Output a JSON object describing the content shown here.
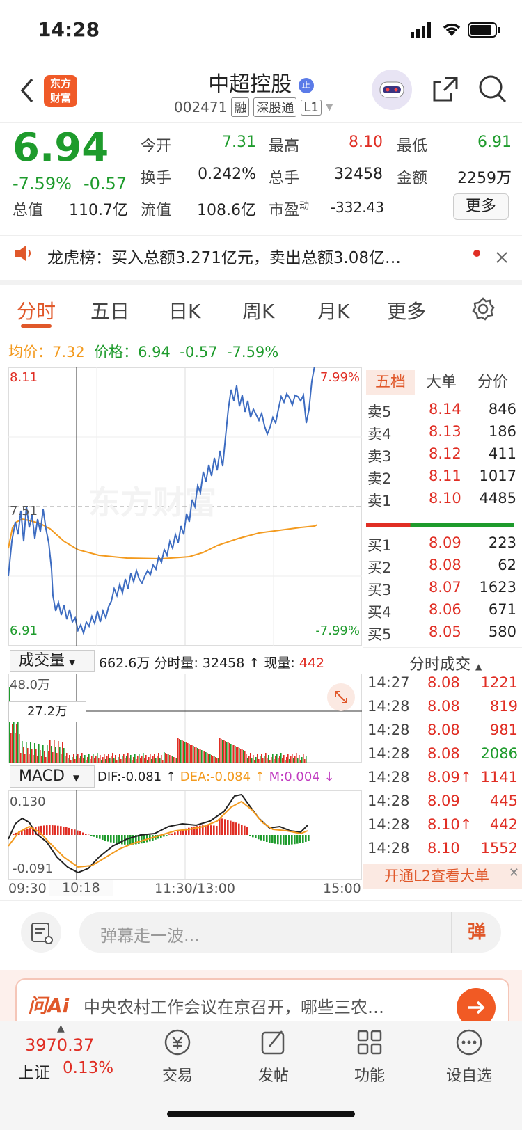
{
  "status_bar": {
    "time": "14:28"
  },
  "header": {
    "logo_text": "东方财富",
    "title": "中超控股",
    "title_badge": "正",
    "code": "002471",
    "tags": [
      "融",
      "深股通",
      "L1"
    ]
  },
  "quote": {
    "price": "6.94",
    "change_pct": "-7.59%",
    "change": "-0.57",
    "fields": [
      {
        "label": "今开",
        "value": "7.31",
        "color": "green"
      },
      {
        "label": "最高",
        "value": "8.10",
        "color": "red"
      },
      {
        "label": "最低",
        "value": "6.91",
        "color": "green"
      },
      {
        "label": "换手",
        "value": "0.242%",
        "color": "black"
      },
      {
        "label": "总手",
        "value": "32458",
        "color": "black"
      },
      {
        "label": "金额",
        "value": "2259万",
        "color": "black"
      },
      {
        "label": "总值",
        "value": "110.7亿",
        "color": "black"
      },
      {
        "label": "流值",
        "value": "108.6亿",
        "color": "black"
      },
      {
        "label": "市盈",
        "value": "-332.43",
        "color": "black",
        "sup": "动"
      }
    ],
    "more_label": "更多"
  },
  "news": {
    "text": "龙虎榜：买入总额3.271亿元，卖出总额3.08亿…"
  },
  "tabs": [
    "分时",
    "五日",
    "日K",
    "周K",
    "月K",
    "更多"
  ],
  "avg_line": {
    "avg_label": "均价：",
    "avg_value": "7.32",
    "price_label": "价格：",
    "price_value": "6.94",
    "change": "-0.57",
    "change_pct": "-7.59%"
  },
  "chart_labels": {
    "top_price": "8.11",
    "bottom_price": "6.91",
    "mid_price": "7.51",
    "top_pct": "7.99%",
    "bottom_pct": "-7.99%",
    "watermark": "东方财富",
    "time_start": "09:30",
    "time_cursor": "10:18",
    "time_mid": "11:30/13:00",
    "time_end": "15:00"
  },
  "volume": {
    "selector": "成交量",
    "total": "662.6万",
    "label": "分时量:",
    "value": "32458",
    "now_label": "现量:",
    "now_value": "442",
    "max": "48.0万",
    "cursor": "27.2万"
  },
  "macd": {
    "selector": "MACD",
    "dif": "DIF:-0.081",
    "dea": "DEA:-0.084",
    "m": "M:0.004",
    "top": "0.130",
    "bottom": "-0.091"
  },
  "orderbook": {
    "tabs": [
      "五档",
      "大单",
      "分价"
    ],
    "sell": [
      {
        "label": "卖5",
        "price": "8.14",
        "vol": "846"
      },
      {
        "label": "卖4",
        "price": "8.13",
        "vol": "186"
      },
      {
        "label": "卖3",
        "price": "8.12",
        "vol": "411"
      },
      {
        "label": "卖2",
        "price": "8.11",
        "vol": "1017"
      },
      {
        "label": "卖1",
        "price": "8.10",
        "vol": "4485"
      }
    ],
    "buy": [
      {
        "label": "买1",
        "price": "8.09",
        "vol": "223"
      },
      {
        "label": "买2",
        "price": "8.08",
        "vol": "62"
      },
      {
        "label": "买3",
        "price": "8.07",
        "vol": "1623"
      },
      {
        "label": "买4",
        "price": "8.06",
        "vol": "671"
      },
      {
        "label": "买5",
        "price": "8.05",
        "vol": "580"
      }
    ]
  },
  "trades": {
    "title": "分时成交",
    "rows": [
      {
        "time": "14:27",
        "price": "8.08",
        "vol": "1221",
        "color": "red"
      },
      {
        "time": "14:28",
        "price": "8.08",
        "vol": "819",
        "color": "red"
      },
      {
        "time": "14:28",
        "price": "8.08",
        "vol": "981",
        "color": "red"
      },
      {
        "time": "14:28",
        "price": "8.08",
        "vol": "2086",
        "color": "green"
      },
      {
        "time": "14:28",
        "price": "8.09↑",
        "vol": "1141",
        "color": "red"
      },
      {
        "time": "14:28",
        "price": "8.09",
        "vol": "445",
        "color": "red"
      },
      {
        "time": "14:28",
        "price": "8.10↑",
        "vol": "442",
        "color": "red"
      },
      {
        "time": "14:28",
        "price": "8.10",
        "vol": "1552",
        "color": "red"
      }
    ],
    "l2_banner": "开通L2查看大单"
  },
  "danmu": {
    "placeholder": "弹幕走一波...",
    "button": "弹"
  },
  "ai_bar": {
    "brand": "问Ai",
    "text": "中央农村工作会议在京召开，哪些三农…"
  },
  "bottom_nav": {
    "index_value": "3970.37",
    "index_name": "上证",
    "index_change": "0.13%",
    "items": [
      "交易",
      "发帖",
      "功能",
      "设自选"
    ]
  },
  "colors": {
    "up": "#e02e24",
    "down": "#1e9b2c",
    "accent": "#e0582a",
    "price_line": "#3d6cc1",
    "avg_line": "#f39a1e"
  }
}
